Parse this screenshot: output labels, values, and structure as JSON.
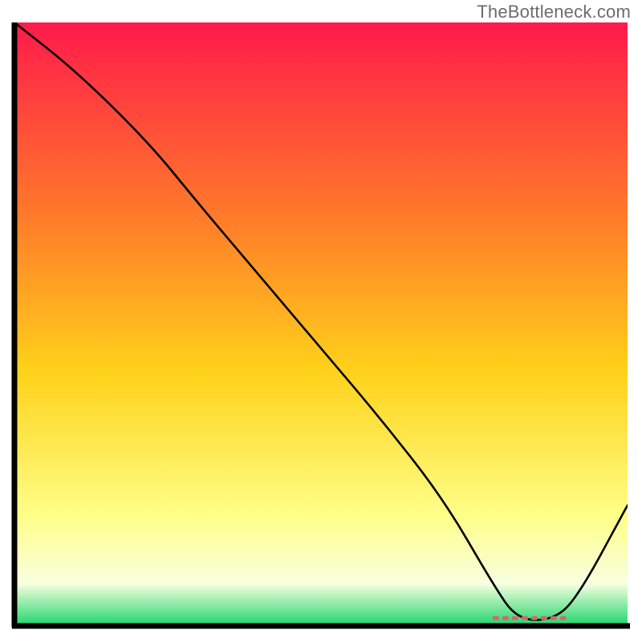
{
  "attribution": "TheBottleneck.com",
  "colors": {
    "gradient_top": "#ff1a4b",
    "gradient_mid_upper": "#ff7a2a",
    "gradient_mid": "#ffd21a",
    "gradient_low": "#ffff8a",
    "gradient_lower": "#f7ffe0",
    "gradient_bottom": "#1dd66b",
    "axis": "#000000",
    "curve": "#000000",
    "annotation": "#d8636d"
  },
  "chart_data": {
    "type": "line",
    "title": "",
    "xlabel": "",
    "ylabel": "",
    "xlim": [
      0,
      100
    ],
    "ylim": [
      0,
      100
    ],
    "series": [
      {
        "name": "bottleneck-curve",
        "x": [
          0,
          10,
          22,
          30,
          40,
          50,
          60,
          70,
          78,
          82,
          88,
          92,
          100
        ],
        "y": [
          100,
          92,
          80,
          70,
          58,
          46,
          34,
          21,
          7,
          1,
          1,
          5,
          20
        ]
      }
    ],
    "annotation": {
      "label": "",
      "x_start": 78,
      "x_end": 90,
      "y": 1.3
    }
  }
}
